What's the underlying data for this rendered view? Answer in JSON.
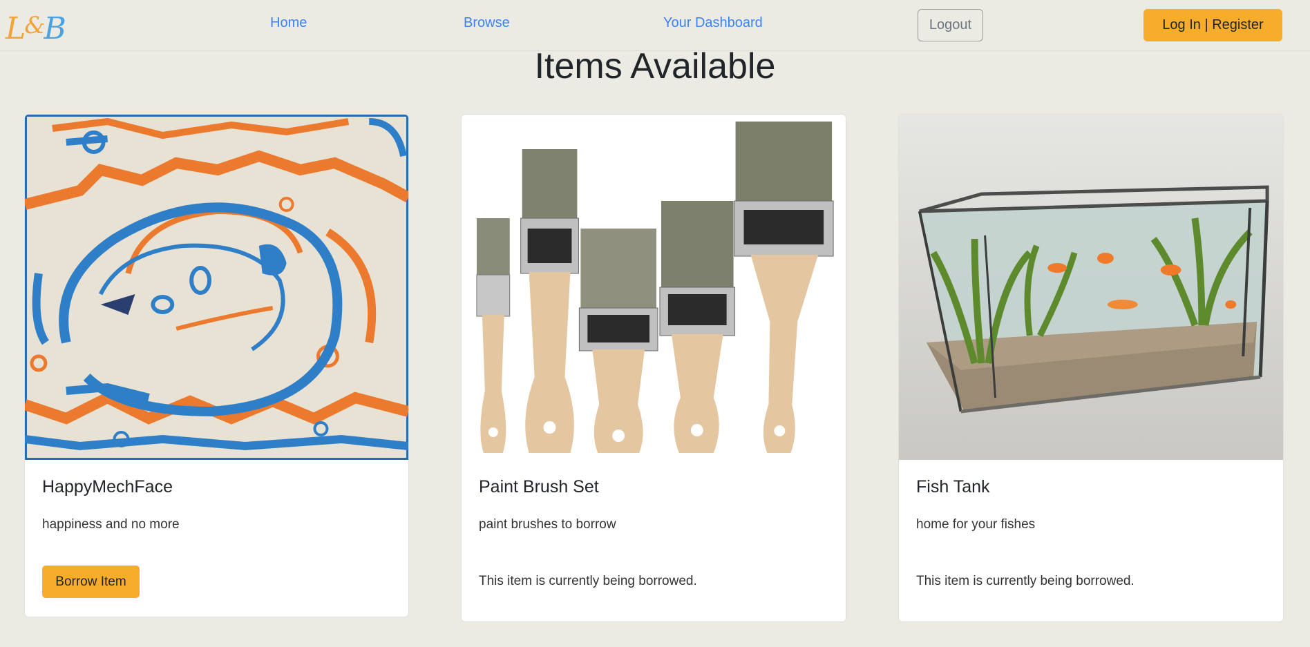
{
  "navbar": {
    "logo_text": "L&B",
    "links": [
      "Home",
      "Browse",
      "Your Dashboard"
    ],
    "logout_label": "Logout",
    "login_label": "Log In | Register",
    "accent_color": "#f7ad2a",
    "link_color": "#3b82f6"
  },
  "page": {
    "title": "Items Available"
  },
  "items": [
    {
      "title": "HappyMechFace",
      "description": "happiness and no more",
      "action_label": "Borrow Item",
      "image": "painting-image"
    },
    {
      "title": "Paint Brush Set",
      "description": "paint brushes to borrow",
      "status": "This item is currently being borrowed.",
      "image": "paint-brushes-image"
    },
    {
      "title": "Fish Tank",
      "description": "home for your fishes",
      "status": "This item is currently being borrowed.",
      "image": "fish-tank-image"
    }
  ]
}
